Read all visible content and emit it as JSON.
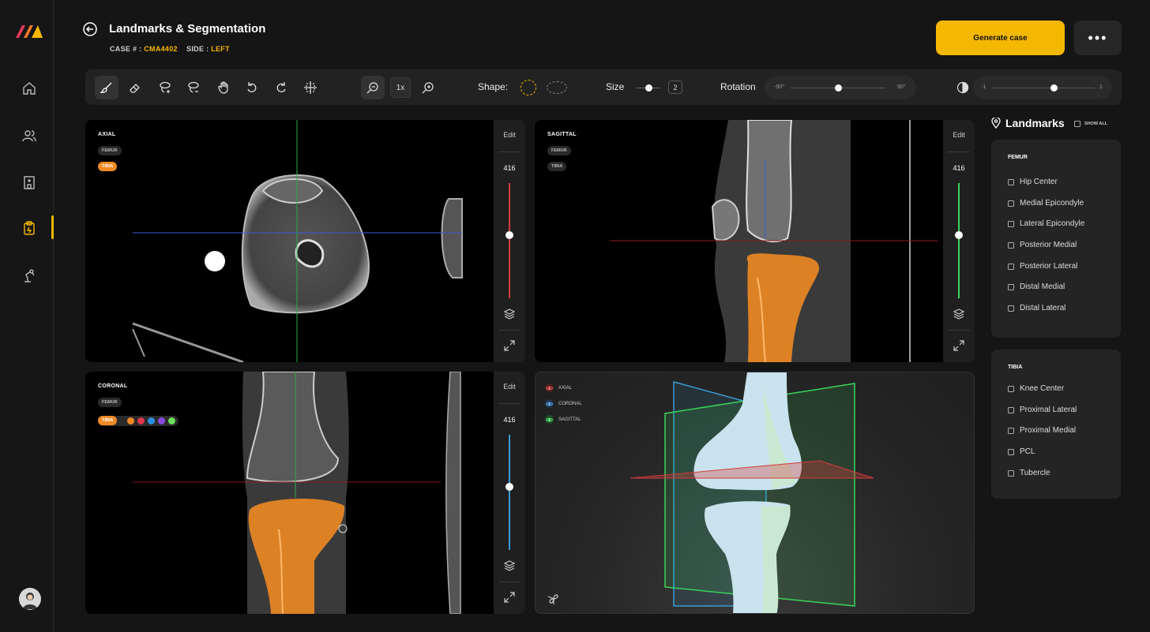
{
  "header": {
    "title": "Landmarks & Segmentation",
    "case_label": "CASE # :",
    "case_value": "CMA4402",
    "side_label": "SIDE :",
    "side_value": "LEFT",
    "generate_label": "Generate case",
    "more_label": "•••"
  },
  "toolbar": {
    "zoom_value": "1x",
    "shape_label": "Shape:",
    "size_label": "Size",
    "size_value": "2",
    "size_level": 0.5,
    "rotation_label": "Rotation",
    "rotation_min": "-90°",
    "rotation_max": "90°",
    "rotation_level": 0.5,
    "contrast_min": "-1",
    "contrast_max": "1",
    "contrast_level": 0.6
  },
  "viewports": {
    "axial": {
      "label": "AXIAL",
      "chip1": "FEMUR",
      "chip2": "TIBIA",
      "edit": "Edit",
      "slice": "416"
    },
    "sagittal": {
      "label": "SAGITTAL",
      "chip1": "FEMUR",
      "chip2": "TIBIA",
      "edit": "Edit",
      "slice": "416"
    },
    "coronal": {
      "label": "CORONAL",
      "chip1": "FEMUR",
      "chip2": "TIBIA",
      "edit": "Edit",
      "slice": "416"
    }
  },
  "three_d": {
    "legend": [
      "AXIAL",
      "CORONAL",
      "SAGITTAL"
    ]
  },
  "colors": {
    "accent": "#f5b800",
    "segment": "#f08a24",
    "axial_plane": "#d33b3b",
    "coronal_plane": "#3b9bd3",
    "sagittal_plane": "#3bd35a"
  },
  "landmarks": {
    "title": "Landmarks",
    "show_all": "SHOW ALL",
    "femur": {
      "title": "FEMUR",
      "items": [
        "Hip Center",
        "Medial Epicondyle",
        "Lateral Epicondyle",
        "Posterior Medial",
        "Posterior Lateral",
        "Distal Medial",
        "Distal Lateral"
      ]
    },
    "tibia": {
      "title": "TIBIA",
      "items": [
        "Knee Center",
        "Proximal Lateral",
        "Proximal Medial",
        "PCL",
        "Tubercle"
      ]
    }
  }
}
